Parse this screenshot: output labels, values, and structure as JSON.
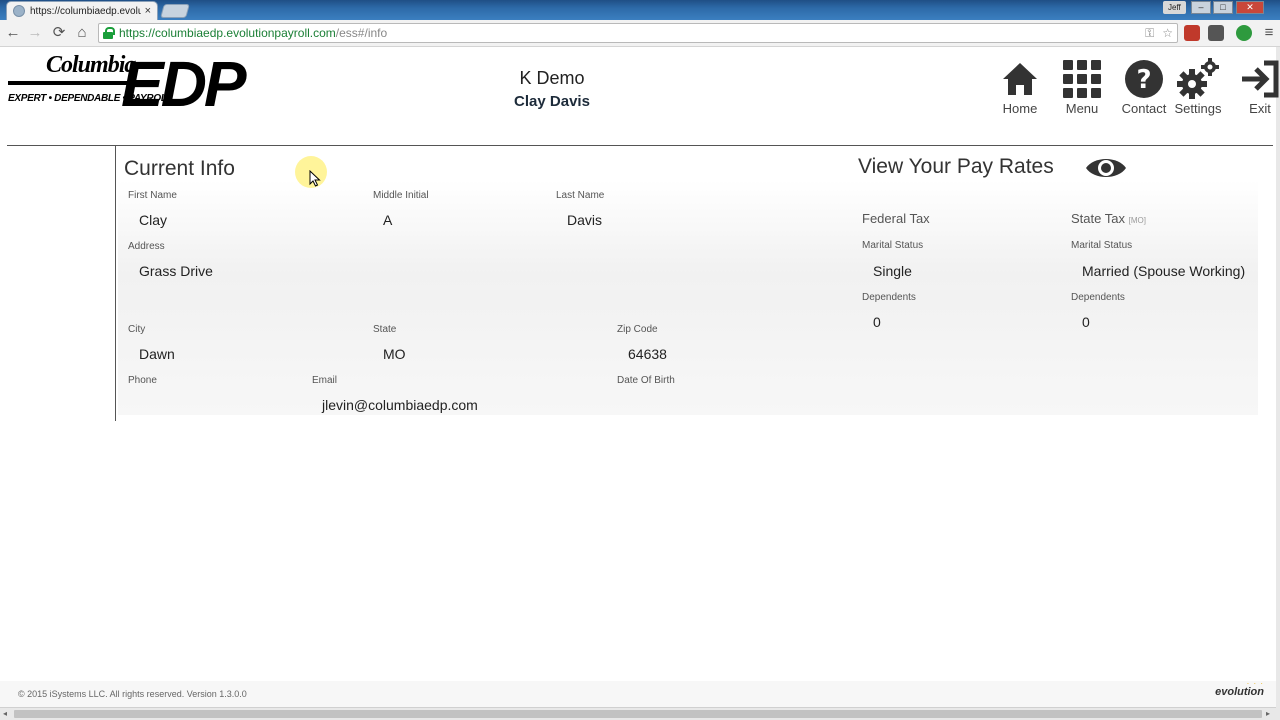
{
  "browser": {
    "tab_title": "https://columbiaedp.evolu",
    "tab_close": "×",
    "user_badge": "Jeff",
    "window_buttons": {
      "minimize": "–",
      "maximize": "□",
      "close": "✕"
    },
    "nav": {
      "back": "←",
      "forward": "→",
      "reload": "⟳",
      "home": "⌂"
    },
    "url_host": "https://columbiaedp.evolutionpayroll.com",
    "url_path": "/ess#/info",
    "omni_icons": {
      "key": "⚿",
      "star": "☆"
    },
    "menu_icon": "≡"
  },
  "logo": {
    "columbia": "Columbia",
    "tagline": "EXPERT • DEPENDABLE • PAYROLL",
    "edp": "EDP"
  },
  "header": {
    "company": "K Demo",
    "employee": "Clay Davis",
    "nav": [
      {
        "label": "Home",
        "icon": "home-icon"
      },
      {
        "label": "Menu",
        "icon": "grid-icon"
      },
      {
        "label": "Contact",
        "icon": "question-icon"
      },
      {
        "label": "Settings",
        "icon": "gears-icon"
      },
      {
        "label": "Exit",
        "icon": "exit-icon"
      }
    ]
  },
  "current_info": {
    "title": "Current Info",
    "first_name": {
      "label": "First Name",
      "value": "Clay"
    },
    "middle_initial": {
      "label": "Middle Initial",
      "value": "A"
    },
    "last_name": {
      "label": "Last Name",
      "value": "Davis"
    },
    "address": {
      "label": "Address",
      "value": "Grass Drive"
    },
    "city": {
      "label": "City",
      "value": "Dawn"
    },
    "state": {
      "label": "State",
      "value": "MO"
    },
    "zip": {
      "label": "Zip Code",
      "value": "64638"
    },
    "phone": {
      "label": "Phone",
      "value": ""
    },
    "email": {
      "label": "Email",
      "value": "jlevin@columbiaedp.com"
    },
    "dob": {
      "label": "Date Of Birth",
      "value": ""
    }
  },
  "pay_rates": {
    "title": "View Your Pay Rates",
    "federal": {
      "title": "Federal Tax",
      "marital_label": "Marital Status",
      "marital_value": "Single",
      "dependents_label": "Dependents",
      "dependents_value": "0"
    },
    "state": {
      "title": "State Tax",
      "state_tag": "[MO]",
      "marital_label": "Marital Status",
      "marital_value": "Married (Spouse Working)",
      "dependents_label": "Dependents",
      "dependents_value": "0"
    }
  },
  "footer": {
    "copyright": "© 2015 iSystems LLC. All rights reserved. Version 1.3.0.0",
    "brand": "evolution",
    "scroll_left": "◂",
    "scroll_right": "▸"
  }
}
